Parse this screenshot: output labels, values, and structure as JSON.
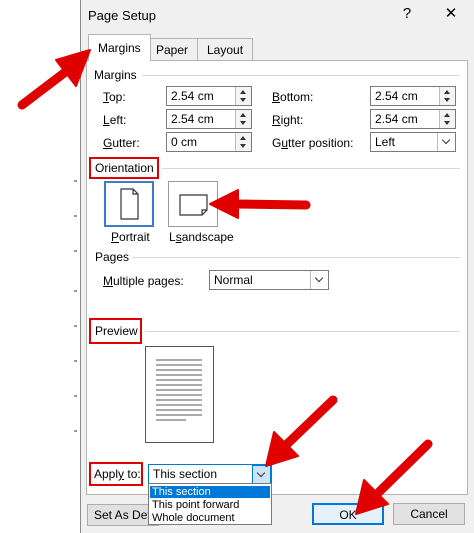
{
  "dialog": {
    "title": "Page Setup",
    "help_label": "?",
    "close_label": "✕"
  },
  "tabs": [
    {
      "label": "Margins"
    },
    {
      "label": "Paper"
    },
    {
      "label": "Layout"
    }
  ],
  "margins": {
    "group_label": "Margins",
    "top": {
      "label_a": "T",
      "label_b": "op:",
      "value": "2.54 cm"
    },
    "bottom": {
      "label_a": "B",
      "label_b": "ottom:",
      "value": "2.54 cm"
    },
    "left": {
      "label_a": "L",
      "label_b": "eft:",
      "value": "2.54 cm"
    },
    "right": {
      "label_a": "R",
      "label_b": "ight:",
      "value": "2.54 cm"
    },
    "gutter": {
      "label_a": "G",
      "label_b": "utter:",
      "value": "0 cm"
    },
    "gutter_position": {
      "label_a": "G",
      "label_b": "u",
      "label_c": "tter position:",
      "value": "Left"
    }
  },
  "orientation": {
    "group_label": "Orientation",
    "portrait": {
      "label_a": "P",
      "label_b": "ortrait"
    },
    "landscape": {
      "label_a": "L",
      "label_b": "s",
      "label_c": "andscape"
    }
  },
  "pages": {
    "group_label": "Pages",
    "multiple_label_a": "M",
    "multiple_label_b": "ultiple pages:",
    "multiple_value": "Normal"
  },
  "preview": {
    "group_label": "Preview"
  },
  "apply_to": {
    "label_a": "Appl",
    "label_b": "y",
    "label_c": " to:",
    "value": "This section",
    "options": [
      "This section",
      "This point forward",
      "Whole document"
    ]
  },
  "buttons": {
    "set_default": "Set As Defa",
    "ok": "OK",
    "cancel": "Cancel"
  },
  "colors": {
    "annotation": "#e00000",
    "selection": "#0078d7"
  }
}
